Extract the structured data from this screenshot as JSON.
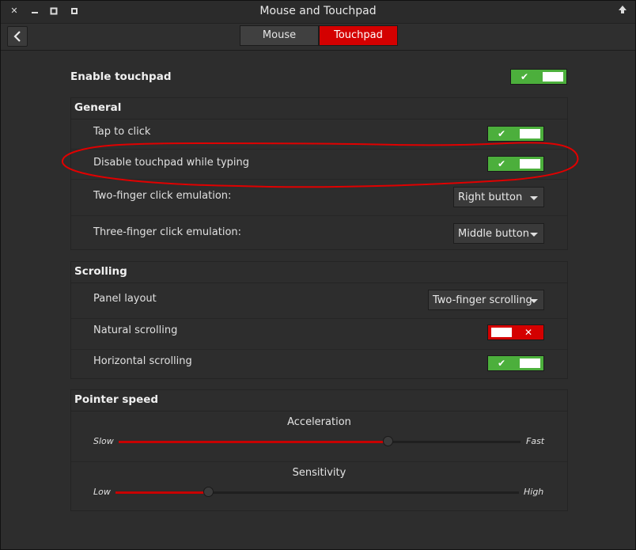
{
  "window": {
    "title": "Mouse and Touchpad",
    "close_icon": "close-icon",
    "minimize_icon": "minimize-icon",
    "maximize_icon": "maximize-icon",
    "up_icon": "up-arrow-icon"
  },
  "toolbar": {
    "back_icon": "back-arrow-icon",
    "tabs": [
      {
        "label": "Mouse",
        "active": false
      },
      {
        "label": "Touchpad",
        "active": true
      }
    ]
  },
  "enable_touchpad": {
    "label": "Enable touchpad",
    "enabled": true
  },
  "general": {
    "title": "General",
    "tap_to_click": {
      "label": "Tap to click",
      "enabled": true
    },
    "disable_while_typing": {
      "label": "Disable touchpad while typing",
      "enabled": true
    },
    "two_finger": {
      "label": "Two-finger click emulation:",
      "value": "Right button"
    },
    "three_finger": {
      "label": "Three-finger click emulation:",
      "value": "Middle button"
    }
  },
  "scrolling": {
    "title": "Scrolling",
    "panel_layout": {
      "label": "Panel layout",
      "value": "Two-finger scrolling"
    },
    "natural": {
      "label": "Natural scrolling",
      "enabled": false
    },
    "horizontal": {
      "label": "Horizontal scrolling",
      "enabled": true
    }
  },
  "pointer_speed": {
    "title": "Pointer speed",
    "acceleration": {
      "label": "Acceleration",
      "min_label": "Slow",
      "max_label": "Fast",
      "value_fraction": 0.67
    },
    "sensitivity": {
      "label": "Sensitivity",
      "min_label": "Low",
      "max_label": "High",
      "value_fraction": 0.23
    }
  },
  "colors": {
    "accent": "#d40000",
    "switch_on": "#4caf3c",
    "annotation": "#e00000"
  }
}
